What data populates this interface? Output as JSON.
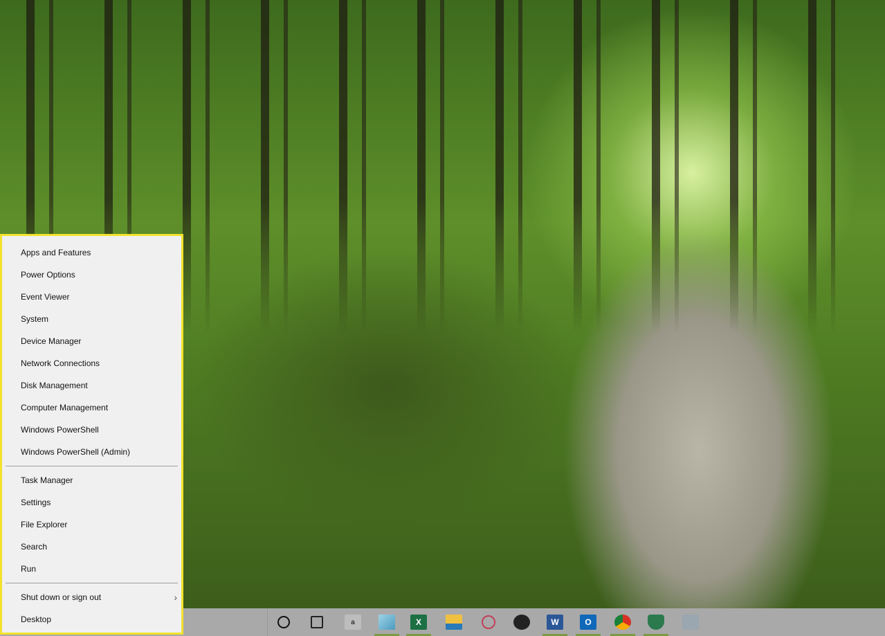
{
  "menu": {
    "group1": [
      "Apps and Features",
      "Power Options",
      "Event Viewer",
      "System",
      "Device Manager",
      "Network Connections",
      "Disk Management",
      "Computer Management",
      "Windows PowerShell",
      "Windows PowerShell (Admin)"
    ],
    "group2": [
      "Task Manager",
      "Settings",
      "File Explorer",
      "Search",
      "Run"
    ],
    "group3": [
      "Shut down or sign out",
      "Desktop"
    ],
    "highlight_color": "#f2e22c"
  },
  "taskbar": {
    "icons": [
      {
        "name": "cortana-icon",
        "running": false
      },
      {
        "name": "task-view-icon",
        "running": false
      },
      {
        "name": "amazon-icon",
        "label": "a",
        "running": false
      },
      {
        "name": "notepad-icon",
        "running": true
      },
      {
        "name": "excel-icon",
        "label": "X",
        "running": true
      },
      {
        "name": "file-explorer-icon",
        "running": false
      },
      {
        "name": "snipping-tool-icon",
        "running": false
      },
      {
        "name": "photos-icon",
        "running": false
      },
      {
        "name": "word-icon",
        "label": "W",
        "running": true
      },
      {
        "name": "outlook-icon",
        "label": "O",
        "running": true
      },
      {
        "name": "chrome-icon",
        "running": true
      },
      {
        "name": "security-shield-icon",
        "running": true
      },
      {
        "name": "network-app-icon",
        "running": false
      }
    ]
  }
}
